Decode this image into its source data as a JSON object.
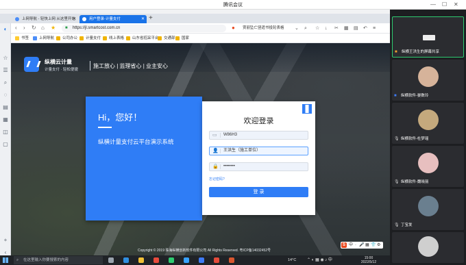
{
  "meeting": {
    "title": "腾讯会议",
    "controls": {
      "minimize": "—",
      "maximize": "☐",
      "close": "✕"
    }
  },
  "browser": {
    "tabs": [
      {
        "label": "上网导航 - 轻快上网 从这里开始",
        "active": false
      },
      {
        "label": "用户登录-计量支付",
        "active": true
      }
    ],
    "new_tab": "+",
    "url": "https://jl.smartcost.com.cn",
    "search_text": "贾丽坠亡竖遗书投轮表格",
    "bookmarks": [
      "书签",
      "上网导航",
      "公司办公",
      "计量支付",
      "线上表格",
      "山东省招采平台",
      "交通部",
      "国家"
    ],
    "rail_icons": [
      "logo-icon",
      "star-icon",
      "list-icon",
      "search-icon",
      "chat-icon",
      "doc-icon",
      "apps-icon",
      "cart-icon",
      "window-icon"
    ]
  },
  "site": {
    "name": "纵横云计量",
    "sub": "计量支付 · 轻松便捷",
    "slogan": "施工放心 | 监理省心 | 业主安心",
    "welcome_hi": "Hi，您好！",
    "platform_name": "纵横计量支付云平台演示系统",
    "login": {
      "title": "欢迎登录",
      "company_value": "W86H3",
      "user_value": "王洪生（施工单位）",
      "password_value": "••••••••",
      "forgot": "忘记密码?",
      "button": "登 录"
    },
    "copyright": "Copyright © 2019 珠海纵横创新软件有限公司 All Rights Reserved. 粤ICP备14032452号"
  },
  "ime": {
    "logo": "S",
    "items": [
      "中",
      "·",
      "🎤",
      "▦",
      "👕",
      "⚙"
    ]
  },
  "taskbar": {
    "search_placeholder": "在这里输入你要搜索的内容",
    "weather": "14°C",
    "time": "15:00",
    "date": "2022/5/12",
    "apps": [
      {
        "name": "taskview-icon",
        "color": "#9aa3ad"
      },
      {
        "name": "edge-icon",
        "color": "#2f8fe0"
      },
      {
        "name": "explorer-icon",
        "color": "#f2c037"
      },
      {
        "name": "chrome-icon",
        "color": "#e84b3c"
      },
      {
        "name": "wechat-icon",
        "color": "#2ecc71"
      },
      {
        "name": "qq-browser-icon",
        "color": "#37a2ff"
      },
      {
        "name": "meeting-icon",
        "color": "#3e7bf5"
      },
      {
        "name": "wps-icon",
        "color": "#e34b3a"
      },
      {
        "name": "ppt-icon",
        "color": "#d9572f"
      }
    ]
  },
  "participants": [
    {
      "name": "纵横王洪生的屏幕共享",
      "avatar": "camera",
      "active": true,
      "color": "#e0e0e0"
    },
    {
      "name": "纵横软件-晏数玲",
      "avatar": "person",
      "active": false,
      "color": "#d6b39a"
    },
    {
      "name": "纵横软件-杜梦瑶",
      "avatar": "person",
      "active": false,
      "color": "#c4a97d"
    },
    {
      "name": "纵横软件-魏晓丽",
      "avatar": "person",
      "active": false,
      "color": "#e7bfbf"
    },
    {
      "name": "丁宝发",
      "avatar": "person",
      "active": false,
      "color": "#6a7f8f"
    },
    {
      "name": "",
      "avatar": "person",
      "active": false,
      "color": "#cfcfcf"
    }
  ]
}
